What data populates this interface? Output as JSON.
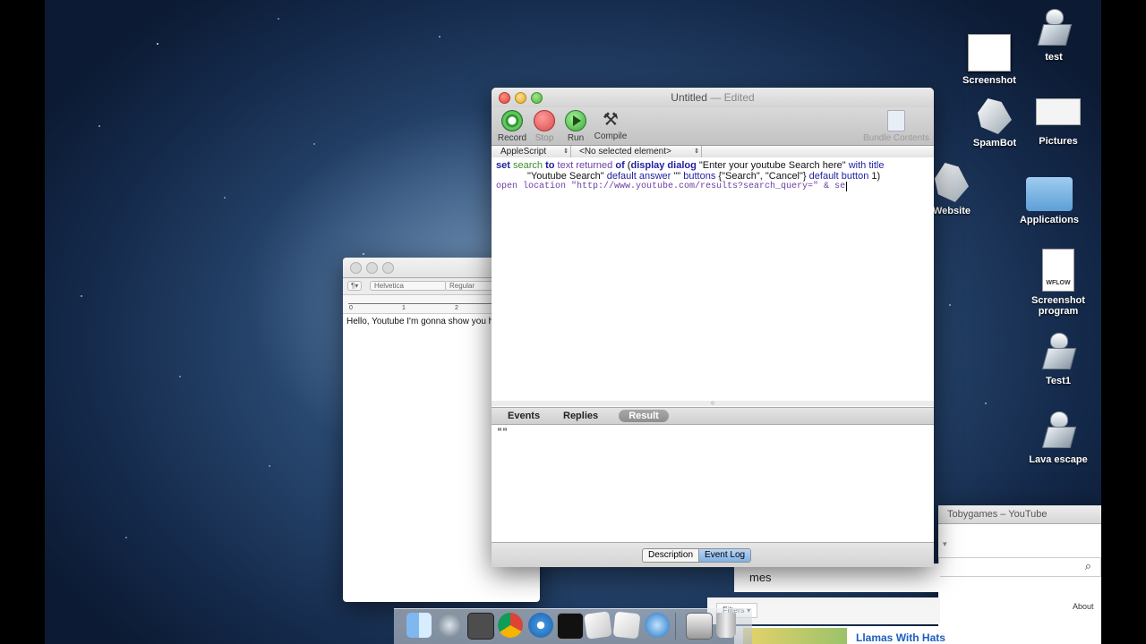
{
  "desktop": {
    "icons": [
      {
        "label": "Screenshot"
      },
      {
        "label": "test"
      },
      {
        "label": "Pictures"
      },
      {
        "label": "SpamBot"
      },
      {
        "label": "Website"
      },
      {
        "label": "Applications"
      },
      {
        "label": "Screenshot program",
        "badge": "WFLOW"
      },
      {
        "label": "Test1"
      },
      {
        "label": "Lava escape"
      }
    ]
  },
  "textedit": {
    "font_family": "Helvetica",
    "font_style": "Regular",
    "paragraph_menu": "¶",
    "ruler_marks": [
      "0",
      "1",
      "2"
    ],
    "body": "Hello, Youtube I'm gonna show you h"
  },
  "script_editor": {
    "title": "Untitled",
    "title_suffix": "— Edited",
    "toolbar": {
      "record": "Record",
      "stop": "Stop",
      "run": "Run",
      "compile": "Compile",
      "bundle": "Bundle Contents"
    },
    "language": "AppleScript",
    "element": "<No selected element>",
    "code": {
      "line1": {
        "t1": "set",
        "t2": "search",
        "t3": "to",
        "t4": "text returned",
        "t5": "of",
        "t6": "(",
        "t7": "display dialog",
        "t8": "\"Enter your youtube Search here\"",
        "t9": "with title"
      },
      "line2": {
        "t1": "\"Youtube Search\"",
        "t2": "default answer",
        "t3": "\"\"",
        "t4": "buttons",
        "t5": "{\"Search\", \"Cancel\"}",
        "t6": "default button",
        "t7": "1)"
      },
      "line3": "open location \"http://www.youtube.com/results?search_query=\" & se"
    },
    "log_tabs": [
      "Events",
      "Replies",
      "Result"
    ],
    "result": "\"\"",
    "footer": {
      "description": "Description",
      "event_log": "Event Log"
    }
  },
  "browser": {
    "title": "Tobygames – YouTube",
    "partial_text": "mes",
    "filters": "Filters",
    "about": "About",
    "video_title": "Llamas With Hats"
  }
}
